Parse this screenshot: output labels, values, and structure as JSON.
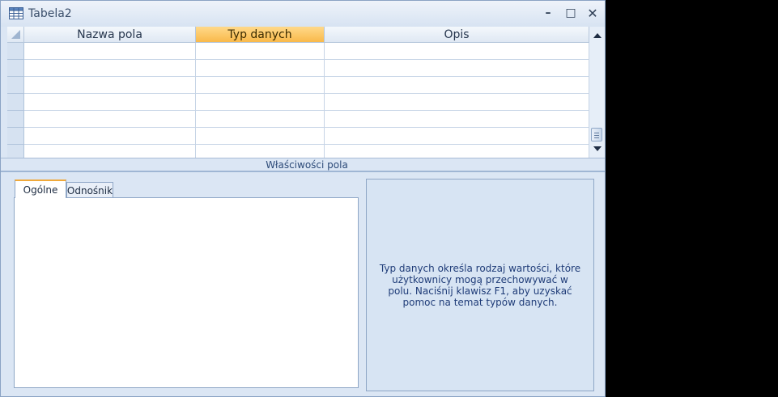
{
  "window": {
    "title": "Tabela2",
    "minimize": "–",
    "maximize": "□",
    "close": "✕"
  },
  "grid": {
    "columns": {
      "field_name": "Nazwa pola",
      "data_type": "Typ danych",
      "description": "Opis"
    },
    "selected_column": "data_type",
    "row_count": 7
  },
  "properties": {
    "section_title": "Właściwości pola",
    "tabs": [
      {
        "label": "Ogólne",
        "active": true
      },
      {
        "label": "Odnośnik",
        "active": false
      }
    ],
    "help_text": "Typ danych określa rodzaj wartości, które użytkownicy mogą przechowywać w polu. Naciśnij klawisz F1, aby uzyskać pomoc na temat typów danych."
  },
  "colors": {
    "selected_header": "#f9b94a",
    "help_text": "#1f3c78"
  }
}
